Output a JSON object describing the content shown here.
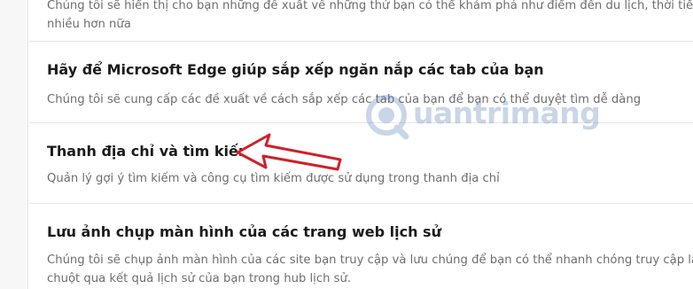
{
  "sections": [
    {
      "title": "",
      "description_lines": [
        "Chúng tôi sẽ hiển thị cho bạn những đề xuất về những thứ bạn có thể khám phá như điểm đến du lịch, thời tiết,",
        "nhiều hơn nữa"
      ]
    },
    {
      "title": "Hãy để Microsoft Edge giúp sắp xếp ngăn nắp các tab của bạn",
      "description_lines": [
        "Chúng tôi sẽ cung cấp các đề xuất về cách sắp xếp các tab của bạn để bạn có thể duyệt tìm dễ dàng"
      ]
    },
    {
      "title": "Thanh địa chỉ và tìm kiếm",
      "description_lines": [
        "Quản lý gợi ý tìm kiếm và công cụ tìm kiếm được sử dụng trong thanh địa chỉ"
      ]
    },
    {
      "title": "Lưu ảnh chụp màn hình của các trang web lịch sử",
      "description_lines": [
        "Chúng tôi sẽ chụp ảnh màn hình của các site bạn truy cập và lưu chúng để bạn có thể nhanh chóng truy cập lại",
        "chuột qua kết quả lịch sử của bạn trong hub lịch sử."
      ]
    }
  ],
  "watermark": {
    "text": "uantrimang",
    "color": "#3c6fb0"
  },
  "annotation": {
    "arrow_color": "#d0202a"
  }
}
